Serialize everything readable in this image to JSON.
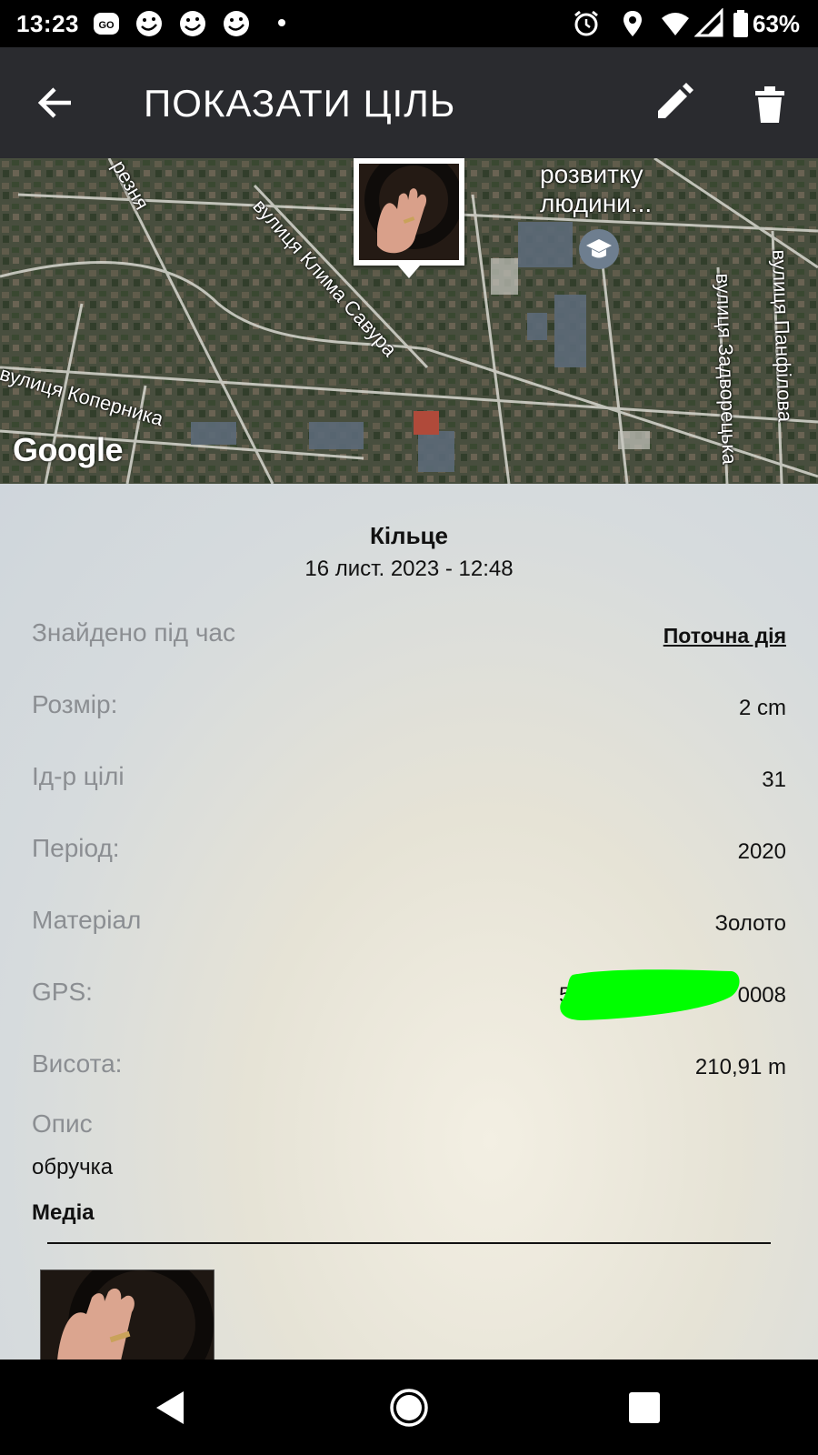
{
  "status_bar": {
    "time": "13:23",
    "battery": "63%",
    "icons": [
      "go-icon",
      "troll-face-icon",
      "troll-face-icon",
      "troll-face-icon",
      "alarm-icon",
      "location-icon",
      "wifi-icon",
      "signal-icon",
      "battery-icon"
    ]
  },
  "app_bar": {
    "title": "ПОКАЗАТИ ЦІЛЬ",
    "back_icon": "arrow-back-icon",
    "edit_icon": "pencil-icon",
    "delete_icon": "trash-icon"
  },
  "map": {
    "street_labels": [
      "резня",
      "вулиця Клима Савура",
      "вулиця Коперника",
      "вулиця Задворецька",
      "вулиця Панфілова"
    ],
    "poi_label_line1": "розвитку",
    "poi_label_line2": "людини...",
    "poi_icon": "school-icon",
    "attribution": "Google",
    "marker_icon": "photo-marker"
  },
  "target": {
    "name": "Кільце",
    "datetime": "16 лист. 2023 - 12:48"
  },
  "rows": [
    {
      "label": "Знайдено під час",
      "value": "Поточна дія"
    },
    {
      "label": "Розмір:",
      "value": "2 cm"
    },
    {
      "label": "Ід-р цілі",
      "value": "31"
    },
    {
      "label": "Період:",
      "value": "2020"
    },
    {
      "label": "Матеріал",
      "value": "Золото"
    },
    {
      "label": "GPS:",
      "value": "5",
      "value_tail": "0008"
    },
    {
      "label": "Висота:",
      "value": "210,91 m"
    }
  ],
  "description": {
    "label": "Опис",
    "value": "обручка"
  },
  "media": {
    "label": "Медіа"
  },
  "nav_bar": {
    "back": "nav-back-icon",
    "home": "nav-home-icon",
    "recents": "nav-recents-icon"
  },
  "colors": {
    "status_bar": "#000000",
    "app_bar": "#2a2b2f",
    "label_grey": "#8b8e92",
    "redaction": "#00ff00"
  }
}
